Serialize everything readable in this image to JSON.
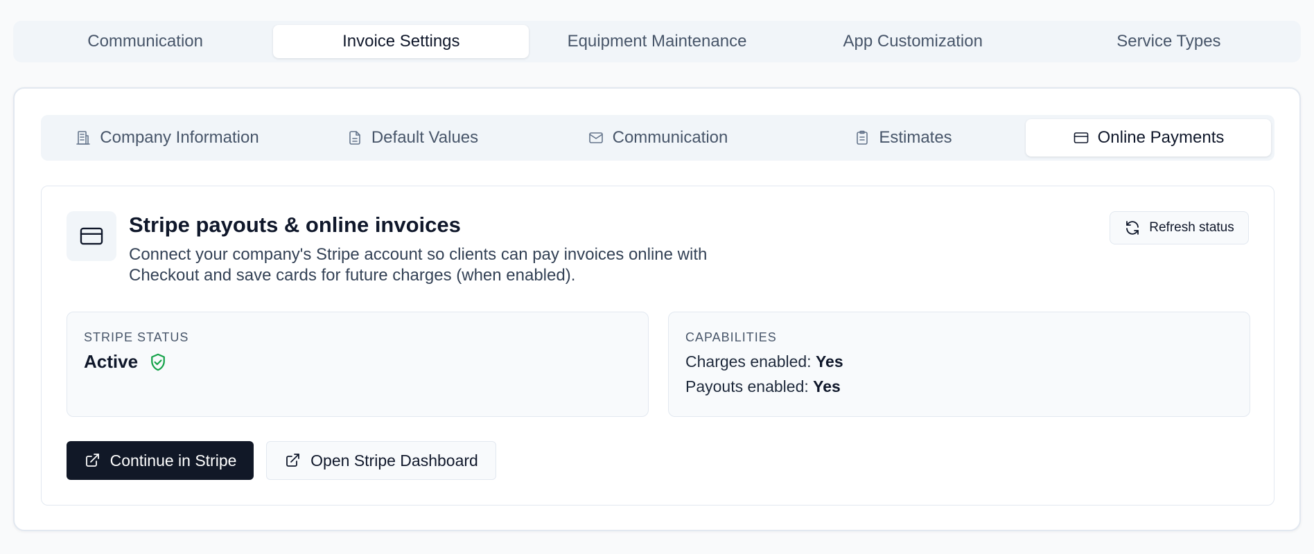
{
  "top_tabs": [
    {
      "label": "Communication",
      "active": false
    },
    {
      "label": "Invoice Settings",
      "active": true
    },
    {
      "label": "Equipment Maintenance",
      "active": false
    },
    {
      "label": "App Customization",
      "active": false
    },
    {
      "label": "Service Types",
      "active": false
    }
  ],
  "sub_tabs": [
    {
      "label": "Company Information",
      "icon": "building-icon",
      "active": false
    },
    {
      "label": "Default Values",
      "icon": "document-icon",
      "active": false
    },
    {
      "label": "Communication",
      "icon": "mail-icon",
      "active": false
    },
    {
      "label": "Estimates",
      "icon": "clipboard-icon",
      "active": false
    },
    {
      "label": "Online Payments",
      "icon": "credit-card-icon",
      "active": true
    }
  ],
  "stripe": {
    "icon": "credit-card-icon",
    "title": "Stripe payouts & online invoices",
    "description": "Connect your company's Stripe account so clients can pay invoices online with Checkout and save cards for future charges (when enabled).",
    "refresh_label": "Refresh status",
    "status_label": "STRIPE STATUS",
    "status_value": "Active",
    "status_color": "#16a34a",
    "capabilities_label": "CAPABILITIES",
    "charges_label": "Charges enabled:",
    "charges_value": "Yes",
    "payouts_label": "Payouts enabled:",
    "payouts_value": "Yes",
    "continue_label": "Continue in Stripe",
    "dashboard_label": "Open Stripe Dashboard"
  },
  "colors": {
    "primary_button": "#111827",
    "tab_bar": "#f1f5f9"
  }
}
